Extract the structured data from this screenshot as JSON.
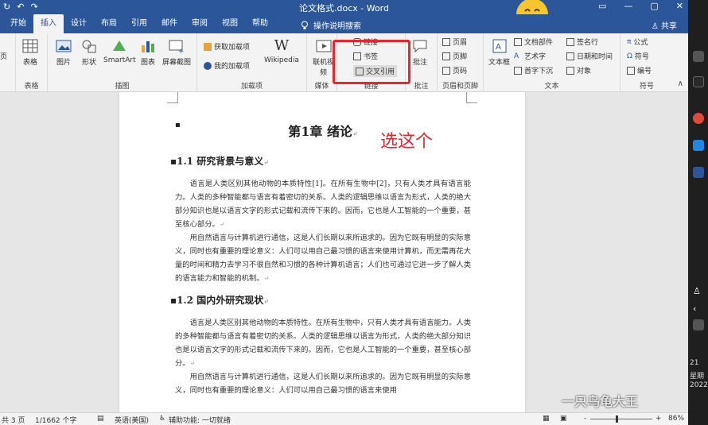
{
  "window": {
    "title": "论文格式.docx - Word",
    "qat": [
      "↻",
      "↶",
      "↷"
    ],
    "controls": [
      "▭",
      "—",
      "▢",
      "✕"
    ]
  },
  "tabs": [
    {
      "label": "开始",
      "active": false
    },
    {
      "label": "插入",
      "active": true
    },
    {
      "label": "设计",
      "active": false
    },
    {
      "label": "布局",
      "active": false
    },
    {
      "label": "引用",
      "active": false
    },
    {
      "label": "邮件",
      "active": false
    },
    {
      "label": "审阅",
      "active": false
    },
    {
      "label": "视图",
      "active": false
    },
    {
      "label": "帮助",
      "active": false
    }
  ],
  "tell_me": "操作说明搜索",
  "share": "共享",
  "ribbon": {
    "pages_label": "页",
    "table": {
      "button": "表格",
      "group": "表格"
    },
    "illustrations": {
      "buttons": [
        "图片",
        "形状",
        "SmartArt",
        "图表",
        "屏幕截图"
      ],
      "group": "插图"
    },
    "addins": {
      "get": "获取加载项",
      "mine": "我的加载项",
      "wikipedia": "Wikipedia",
      "group": "加载项"
    },
    "media": {
      "button": "联机视频",
      "group": "媒体"
    },
    "links": {
      "items": [
        "链接",
        "书签",
        "交叉引用"
      ],
      "group": "链接"
    },
    "comments": {
      "button": "批注",
      "group": "批注"
    },
    "header_footer": {
      "items": [
        "页眉",
        "页脚",
        "页码"
      ],
      "group": "页眉和页脚"
    },
    "text": {
      "textbox": "文本框",
      "col1": [
        "文档部件",
        "艺术字",
        "首字下沉"
      ],
      "col2": [
        "签名行",
        "日期和时间",
        "对象"
      ],
      "group": "文本"
    },
    "symbols": {
      "items": [
        "公式",
        "符号",
        "编号"
      ],
      "group": "符号"
    }
  },
  "annotation": "选这个",
  "document": {
    "chapter": "第1章  绪论",
    "sections": [
      {
        "heading": "1.1 研究背景与意义",
        "paragraphs": [
          "语言是人类区别其他动物的本质特性[1]。在所有生物中[2]，只有人类才具有语言能力。人类的多种智能都与语言有着密切的关系。人类的逻辑思维以语言为形式，人类的绝大部分知识也是以语言文字的形式记载和流传下来的。因而，它也是人工智能的一个重要，甚至核心部分。",
          "用自然语言与计算机进行通信，这是人们长期以来所追求的。因为它既有明显的实际意义，同时也有重要的理论意义：人们可以用自己最习惯的语言来使用计算机，而无需再花大量的时间和精力去学习不很自然和习惯的各种计算机语言；人们也可通过它进一步了解人类的语言能力和智能的机制。"
        ]
      },
      {
        "heading": "1.2 国内外研究现状",
        "paragraphs": [
          "语言是人类区别其他动物的本质特性。在所有生物中，只有人类才具有语言能力。人类的多种智能都与语言有着密切的关系。人类的逻辑思维以语言为形式，人类的绝大部分知识也是以语言文字的形式记载和流传下来的。因而，它也是人工智能的一个重要，甚至核心部分。",
          "用自然语言与计算机进行通信，这是人们长期以来所追求的。因为它既有明显的实际意义，同时也有重要的理论意义：人们可以用自己最习惯的语言来使用"
        ]
      }
    ]
  },
  "status": {
    "pages": "共 3 页",
    "words": "1/1662 个字",
    "language": "英语(美国)",
    "accessibility": "辅助功能: 一切就绪",
    "zoom": "86%",
    "zoom_minus": "-",
    "zoom_plus": "+"
  },
  "watermark": "一只乌龟大王",
  "taskbar_text": [
    "21",
    "星期",
    "2022"
  ],
  "colors": {
    "accent": "#2b579a",
    "highlight": "#e8262b"
  }
}
